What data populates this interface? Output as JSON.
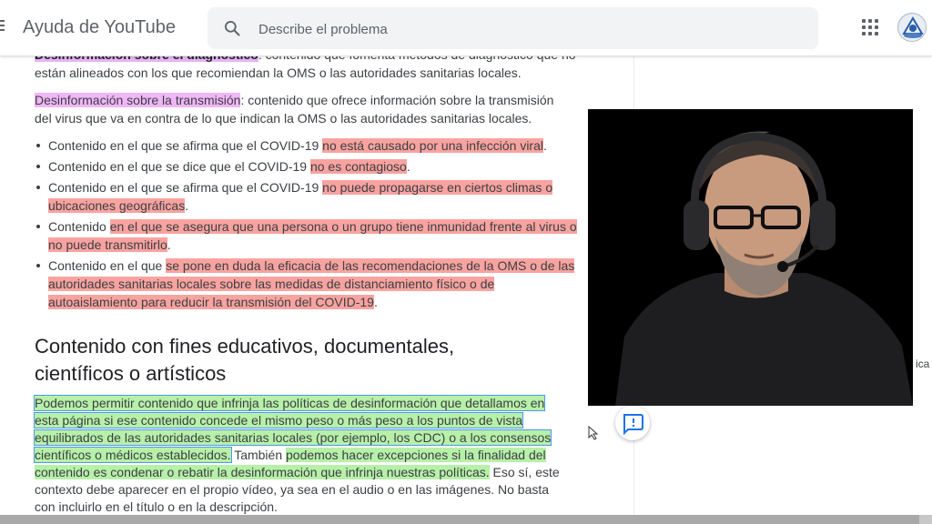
{
  "header": {
    "title": "Ayuda de YouTube",
    "search_placeholder": "Describe el problema"
  },
  "content": {
    "p1_label": "Desinformación sobre el diagnóstico",
    "p1_text_a": ": contenido que fomenta métodos de diagnóstico que no están",
    "p1_text_b": "alineados con los que recomiendan la OMS o las autoridades sanitarias locales.",
    "p2_label": "Desinformación sobre la transmisión",
    "p2_text": ": contenido que ofrece información sobre la transmisión del virus que va en contra de lo que indican la OMS o las autoridades sanitarias locales.",
    "claims": [
      {
        "plain": "Contenido en el que se afirma que el COVID-19 ",
        "hl": "no está causado por una infección viral",
        "tail": "."
      },
      {
        "plain": "Contenido en el que se dice que el COVID-19 ",
        "hl": "no es contagioso",
        "tail": "."
      },
      {
        "plain": "Contenido en el que se afirma que el COVID-19 ",
        "hl": "no puede propagarse en ciertos climas o ubicaciones geográficas",
        "tail": "."
      },
      {
        "plain": "Contenido ",
        "hl": "en el que se asegura que una persona o un grupo tiene inmunidad frente al virus o no puede transmitirlo",
        "tail": "."
      },
      {
        "plain": "Contenido en el que ",
        "hl": "se pone en duda la eficacia de las recomendaciones de la OMS o de las autoridades sanitarias locales sobre las medidas de distanciamiento físico o de autoaislamiento para reducir la transmisión del COVID-19",
        "tail": "."
      }
    ],
    "section_heading": "Contenido con fines educativos, documentales, científicos o artísticos",
    "p3_boxed": "Podemos permitir contenido que infrinja las políticas de desinformación que detallamos en esta página si ese contenido concede el mismo peso o más peso a los puntos de vista equilibrados de las autoridades sanitarias locales (por ejemplo, los CDC) o a los consensos científicos o médicos establecidos.",
    "p3_plain_a": " También ",
    "p3_green": "podemos hacer excepciones si la finalidad del contenido es condenar o rebatir la desinformación que infrinja nuestras políticas.",
    "p3_plain_b": " Eso sí, este contexto debe aparecer en el propio vídeo, ya sea en el audio o en las imágenes. No basta con incluirlo en el título o en la descripción."
  },
  "edge": {
    "clipped_text": "ica"
  }
}
